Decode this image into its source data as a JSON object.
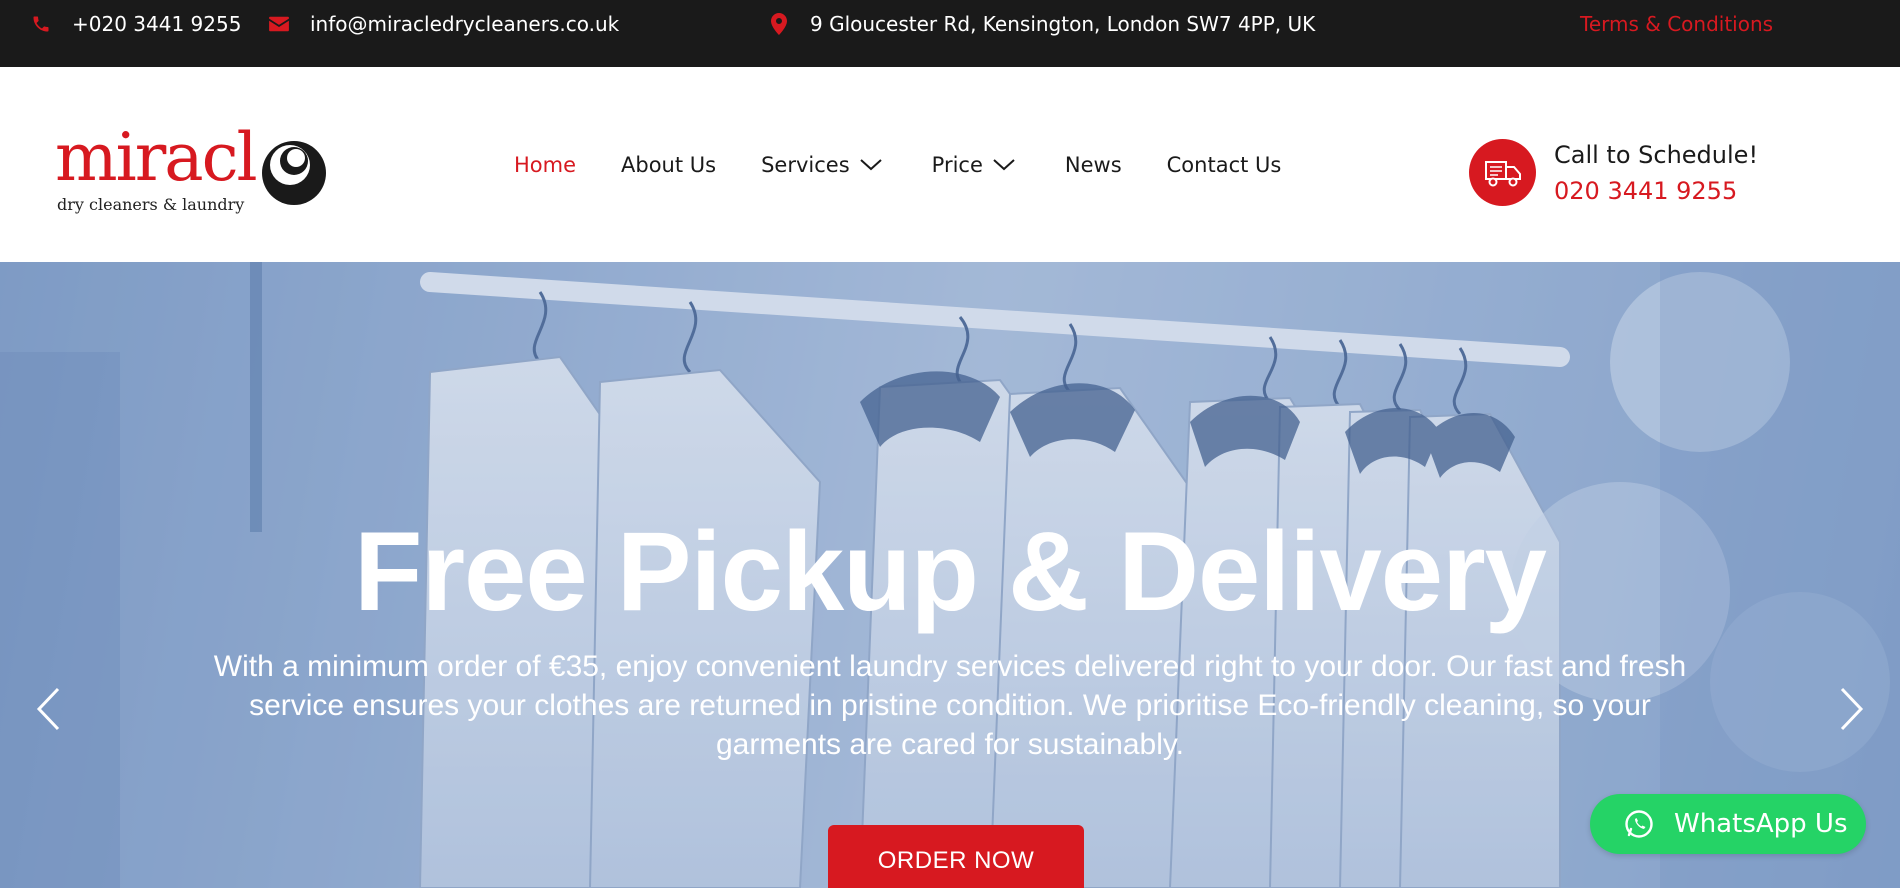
{
  "topbar": {
    "phone": "+020 3441 9255",
    "email": "info@miracledrycleaners.co.uk",
    "address": "9 Gloucester Rd, Kensington, London SW7 4PP, UK",
    "terms": "Terms & Conditions"
  },
  "logo": {
    "word": "miracl",
    "tagline": "dry cleaners  & laundry"
  },
  "nav": {
    "items": [
      {
        "label": "Home",
        "active": true
      },
      {
        "label": "About Us"
      },
      {
        "label": "Services",
        "dropdown": true
      },
      {
        "label": "Price",
        "dropdown": true
      },
      {
        "label": "News"
      },
      {
        "label": "Contact Us"
      }
    ]
  },
  "schedule": {
    "title": "Call to Schedule!",
    "phone": "020 3441 9255"
  },
  "hero": {
    "title": "Free Pickup & Delivery",
    "subtitle": "With a minimum order of €35, enjoy convenient laundry services delivered right to your door. Our fast and fresh service ensures your clothes are returned in pristine condition. We prioritise Eco-friendly cleaning, so your garments are cared for sustainably.",
    "button": "ORDER NOW"
  },
  "whatsapp": {
    "label": "WhatsApp Us"
  },
  "colors": {
    "brand_red": "#d71920",
    "topbar_bg": "#1a1a1a",
    "whatsapp_green": "#25d366"
  },
  "icons": [
    "phone-icon",
    "envelope-icon",
    "map-pin-icon",
    "delivery-truck-icon",
    "chevron-down-icon",
    "chevron-left-icon",
    "chevron-right-icon",
    "whatsapp-icon"
  ]
}
